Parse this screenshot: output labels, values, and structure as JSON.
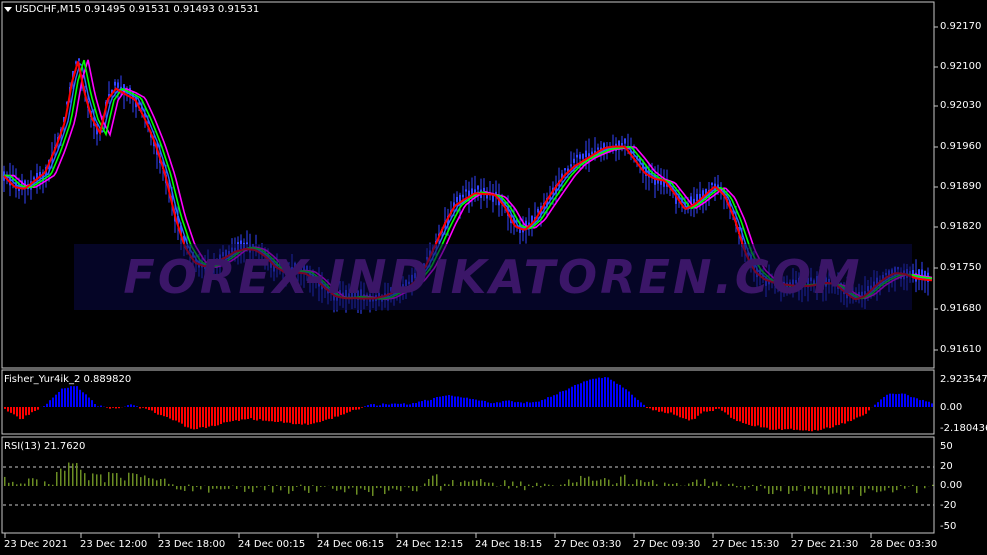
{
  "main_panel": {
    "title": "USDCHF,M15  0.91495 0.91531 0.91493 0.91531",
    "menu_icon": "triangle-down-icon",
    "watermark": "FOREX-INDIKATOREN.COM",
    "price_ticks": [
      "0.92170",
      "0.92100",
      "0.92030",
      "0.91960",
      "0.91890",
      "0.91820",
      "0.91750",
      "0.91680",
      "0.91610"
    ]
  },
  "fisher_panel": {
    "title": "Fisher_Yur4ik_2 0.889820",
    "ticks": [
      "2.923547",
      "0.00",
      "-2.180436"
    ]
  },
  "rsi_panel": {
    "title": "RSI(13) 21.7620",
    "ticks": [
      "50",
      "20",
      "0.00",
      "-20",
      "-50"
    ]
  },
  "time_axis": [
    "23 Dec 2021",
    "23 Dec 12:00",
    "23 Dec 18:00",
    "24 Dec 00:15",
    "24 Dec 06:15",
    "24 Dec 12:15",
    "24 Dec 18:15",
    "27 Dec 03:30",
    "27 Dec 09:30",
    "27 Dec 15:30",
    "27 Dec 21:30",
    "28 Dec 03:30"
  ],
  "colors": {
    "background": "#000000",
    "candles": "#3344ff",
    "ma_red": "#ff0000",
    "ma_magenta": "#ff00ff",
    "ma_green": "#00ff00",
    "ma_blue": "#2a6bff",
    "fisher_pos": "#0000ff",
    "fisher_neg": "#ff0000",
    "rsi_bars": "#6b8e23",
    "watermark": "#3a1670",
    "watermark_band": "#0a0a3a"
  }
}
